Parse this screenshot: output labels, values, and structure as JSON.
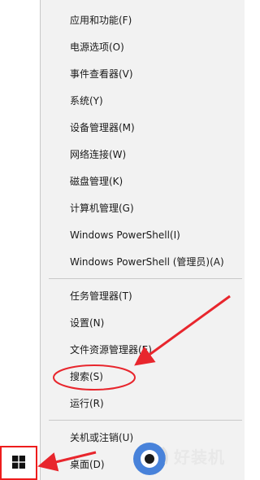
{
  "menu": {
    "items_top": [
      "应用和功能(F)",
      "电源选项(O)",
      "事件查看器(V)",
      "系统(Y)",
      "设备管理器(M)",
      "网络连接(W)",
      "磁盘管理(K)",
      "计算机管理(G)",
      "Windows PowerShell(I)",
      "Windows PowerShell (管理员)(A)"
    ],
    "items_middle": [
      "任务管理器(T)",
      "设置(N)",
      "文件资源管理器(E)",
      "搜索(S)",
      "运行(R)"
    ],
    "items_bottom": [
      "关机或注销(U)",
      "桌面(D)"
    ]
  },
  "taskbar": {
    "start_icon": "windows-logo-icon"
  },
  "annotation": {
    "color": "#e8262d",
    "highlight": "搜索(S)"
  },
  "watermark": {
    "text": "好装机"
  }
}
